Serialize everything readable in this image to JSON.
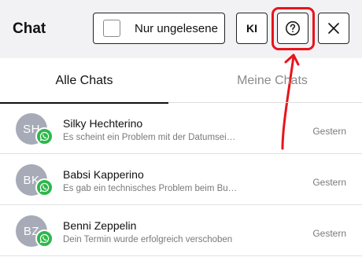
{
  "header": {
    "title": "Chat",
    "unread_label": "Nur ungelesene",
    "ki_label": "KI"
  },
  "tabs": [
    {
      "label": "Alle Chats",
      "active": true
    },
    {
      "label": "Meine Chats",
      "active": false
    }
  ],
  "chats": [
    {
      "initials": "SH",
      "name": "Silky Hechterino",
      "preview": "Es scheint ein Problem mit der Datumseingabe zu geben",
      "time": "Gestern",
      "channel": "whatsapp-icon"
    },
    {
      "initials": "BK",
      "name": "Babsi Kapperino",
      "preview": "Es gab ein technisches Problem beim Buchen",
      "time": "Gestern",
      "channel": "whatsapp-icon"
    },
    {
      "initials": "BZ",
      "name": "Benni Zeppelin",
      "preview": "Dein Termin wurde erfolgreich verschoben",
      "time": "Gestern",
      "channel": "whatsapp-icon"
    }
  ],
  "colors": {
    "header_bg": "#f2f2f4",
    "annotation_red": "#e8141c",
    "whatsapp_green": "#2db84b",
    "avatar_gray": "#a7abb7"
  }
}
